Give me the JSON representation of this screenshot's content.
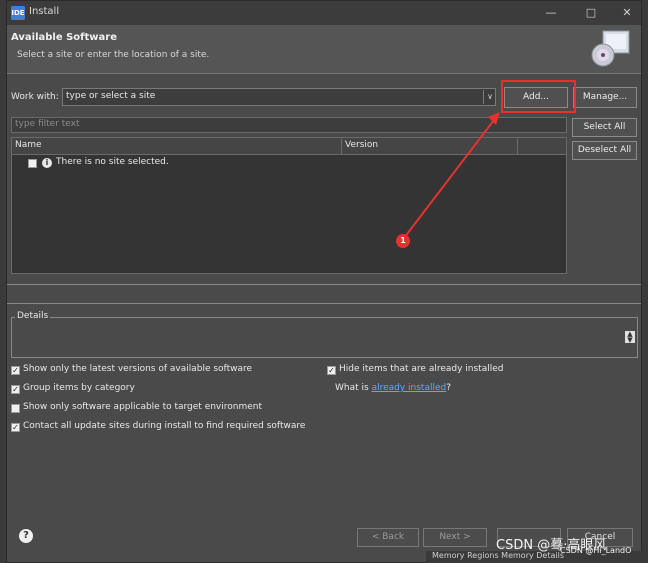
{
  "window": {
    "title": "Install",
    "app_icon": "IDE",
    "controls": [
      "minimize-icon",
      "maximize-icon",
      "close-icon"
    ]
  },
  "header": {
    "title": "Available Software",
    "subtitle": "Select a site or enter the location of a site."
  },
  "work_with": {
    "label": "Work with:",
    "value": "type or select a site",
    "add_label": "Add...",
    "manage_label": "Manage..."
  },
  "filter": {
    "placeholder": "type filter text"
  },
  "side_buttons": {
    "select_all": "Select All",
    "deselect_all": "Deselect All"
  },
  "table": {
    "columns": [
      "Name",
      "Version"
    ],
    "message": "There is no site selected."
  },
  "details": {
    "label": "Details"
  },
  "options": {
    "latest": "Show only the latest versions of available software",
    "group": "Group items by category",
    "target_env": "Show only software applicable to target environment",
    "contact_sites": "Contact all update sites during install to find required software",
    "hide_installed": "Hide items that are already installed",
    "what_is_prefix": "What is ",
    "what_is_link": "already installed",
    "what_is_suffix": "?"
  },
  "footer": {
    "back": "< Back",
    "next": "Next >",
    "cancel": "Cancel"
  },
  "annotation": {
    "marker_number": "1",
    "color": "#e6322f"
  },
  "watermark": {
    "text": "CSDN @蓦·高眼风",
    "handle": "CSDN @Hi_LandO"
  },
  "background": {
    "bottom_strip": "Memory Regions   Memory Details"
  }
}
